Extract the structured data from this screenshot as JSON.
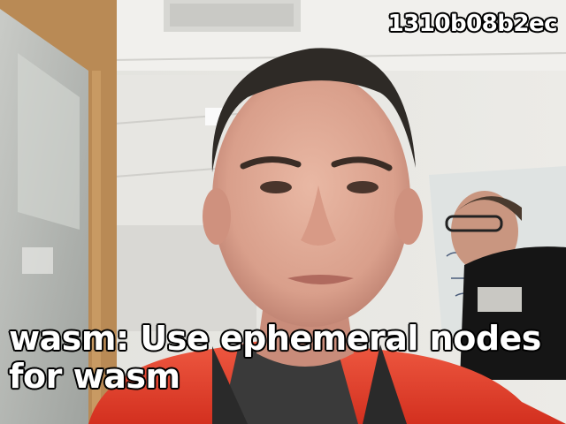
{
  "overlay": {
    "commit_hash": "1310b08b2ec",
    "caption": "wasm: Use ephemeral nodes for wasm"
  },
  "colors": {
    "overlay_text": "#ffffff",
    "overlay_outline": "#000000",
    "jacket": "#e0402e",
    "wall": "#e9e9e6"
  }
}
